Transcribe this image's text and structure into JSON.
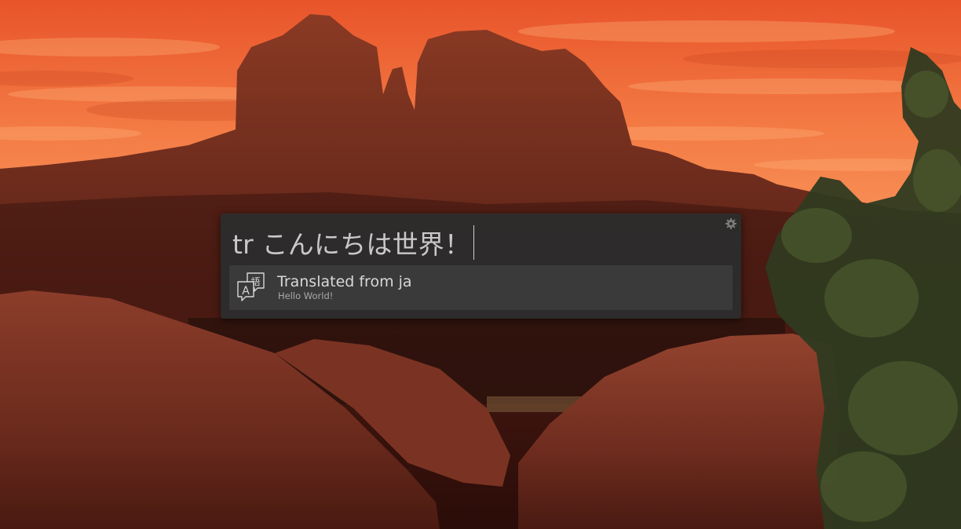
{
  "desktop": {
    "wallpaper_icon": "red-rock-sunset-landscape"
  },
  "launcher": {
    "query": "tr こんにちは世界！",
    "settings_icon": "gear-icon",
    "results": [
      {
        "icon": "translate-icon",
        "title": "Translated from ja",
        "description": "Hello World!"
      }
    ]
  },
  "colors": {
    "panel_bg": "#2c2c2c",
    "result_bg": "#3a3a3a",
    "text_primary": "#d8d8d8",
    "text_secondary": "#a9a9a9"
  }
}
